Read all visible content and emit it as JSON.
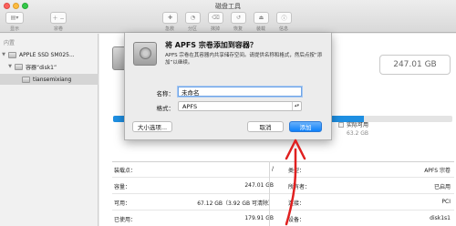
{
  "window": {
    "title": "磁盘工具",
    "toolbar": [
      {
        "label": "显示",
        "icon": "sidebar-icon"
      },
      {
        "label": "宗卷",
        "icon": "volume-icon"
      },
      {
        "label": "急救",
        "icon": "first-aid-icon"
      },
      {
        "label": "分区",
        "icon": "partition-icon"
      },
      {
        "label": "抹掉",
        "icon": "erase-icon"
      },
      {
        "label": "恢复",
        "icon": "restore-icon"
      },
      {
        "label": "装载",
        "icon": "mount-icon"
      },
      {
        "label": "信息",
        "icon": "info-icon"
      }
    ]
  },
  "sidebar": {
    "section": "内置",
    "items": [
      {
        "label": "APPLE SSD SM025...",
        "level": 0
      },
      {
        "label": "容器“disk1”",
        "level": 1
      },
      {
        "label": "tiansemixiang",
        "level": 2
      }
    ]
  },
  "main": {
    "capacity": "247.01 GB",
    "available": {
      "label": "实际可用",
      "value": "63.2 GB"
    },
    "usage_fraction": 0.74,
    "info_left": [
      {
        "label": "装载点：",
        "value": "/"
      },
      {
        "label": "容量：",
        "value": "247.01 GB"
      },
      {
        "label": "可用：",
        "value": "67.12 GB（3.92 GB 可清除）"
      },
      {
        "label": "已使用：",
        "value": "179.91 GB"
      }
    ],
    "info_right": [
      {
        "label": "类型：",
        "value": "APFS 宗卷"
      },
      {
        "label": "所有者：",
        "value": "已启用"
      },
      {
        "label": "连接：",
        "value": "PCI"
      },
      {
        "label": "设备：",
        "value": "disk1s1"
      }
    ]
  },
  "dialog": {
    "title": "将 APFS 宗卷添加到容器？",
    "description": "APFS 宗卷在其容器内共享储存空间。请提供名称和格式，然后点按“添加”以继续。",
    "name_label": "名称：",
    "name_value": "未命名",
    "format_label": "格式：",
    "format_value": "APFS",
    "size_options_button": "大小选项...",
    "cancel_button": "取消",
    "add_button": "添加"
  },
  "colors": {
    "accent": "#1e8fe2",
    "annotation_arrow": "#e02020"
  }
}
